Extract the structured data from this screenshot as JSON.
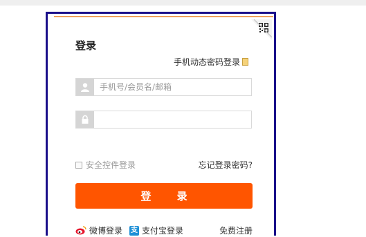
{
  "login": {
    "title": "登录",
    "phone_login": "手机动态密码登录",
    "username_placeholder": "手机号/会员名/邮箱",
    "password_placeholder": "",
    "safe_control_login": "安全控件登录",
    "forgot_password": "忘记登录密码?",
    "submit": "登 录",
    "weibo_login": "微博登录",
    "alipay_login": "支付宝登录",
    "alipay_icon_glyph": "支",
    "register": "免费注册"
  },
  "colors": {
    "frame_border": "#1a0f8a",
    "panel_top_border": "#f0a05a",
    "button": "#ff5500",
    "weibo": "#e6162d",
    "alipay": "#1d8fd6"
  },
  "icons": [
    "qr-code-icon",
    "phone-icon",
    "user-icon",
    "lock-icon",
    "weibo-icon",
    "alipay-icon"
  ]
}
